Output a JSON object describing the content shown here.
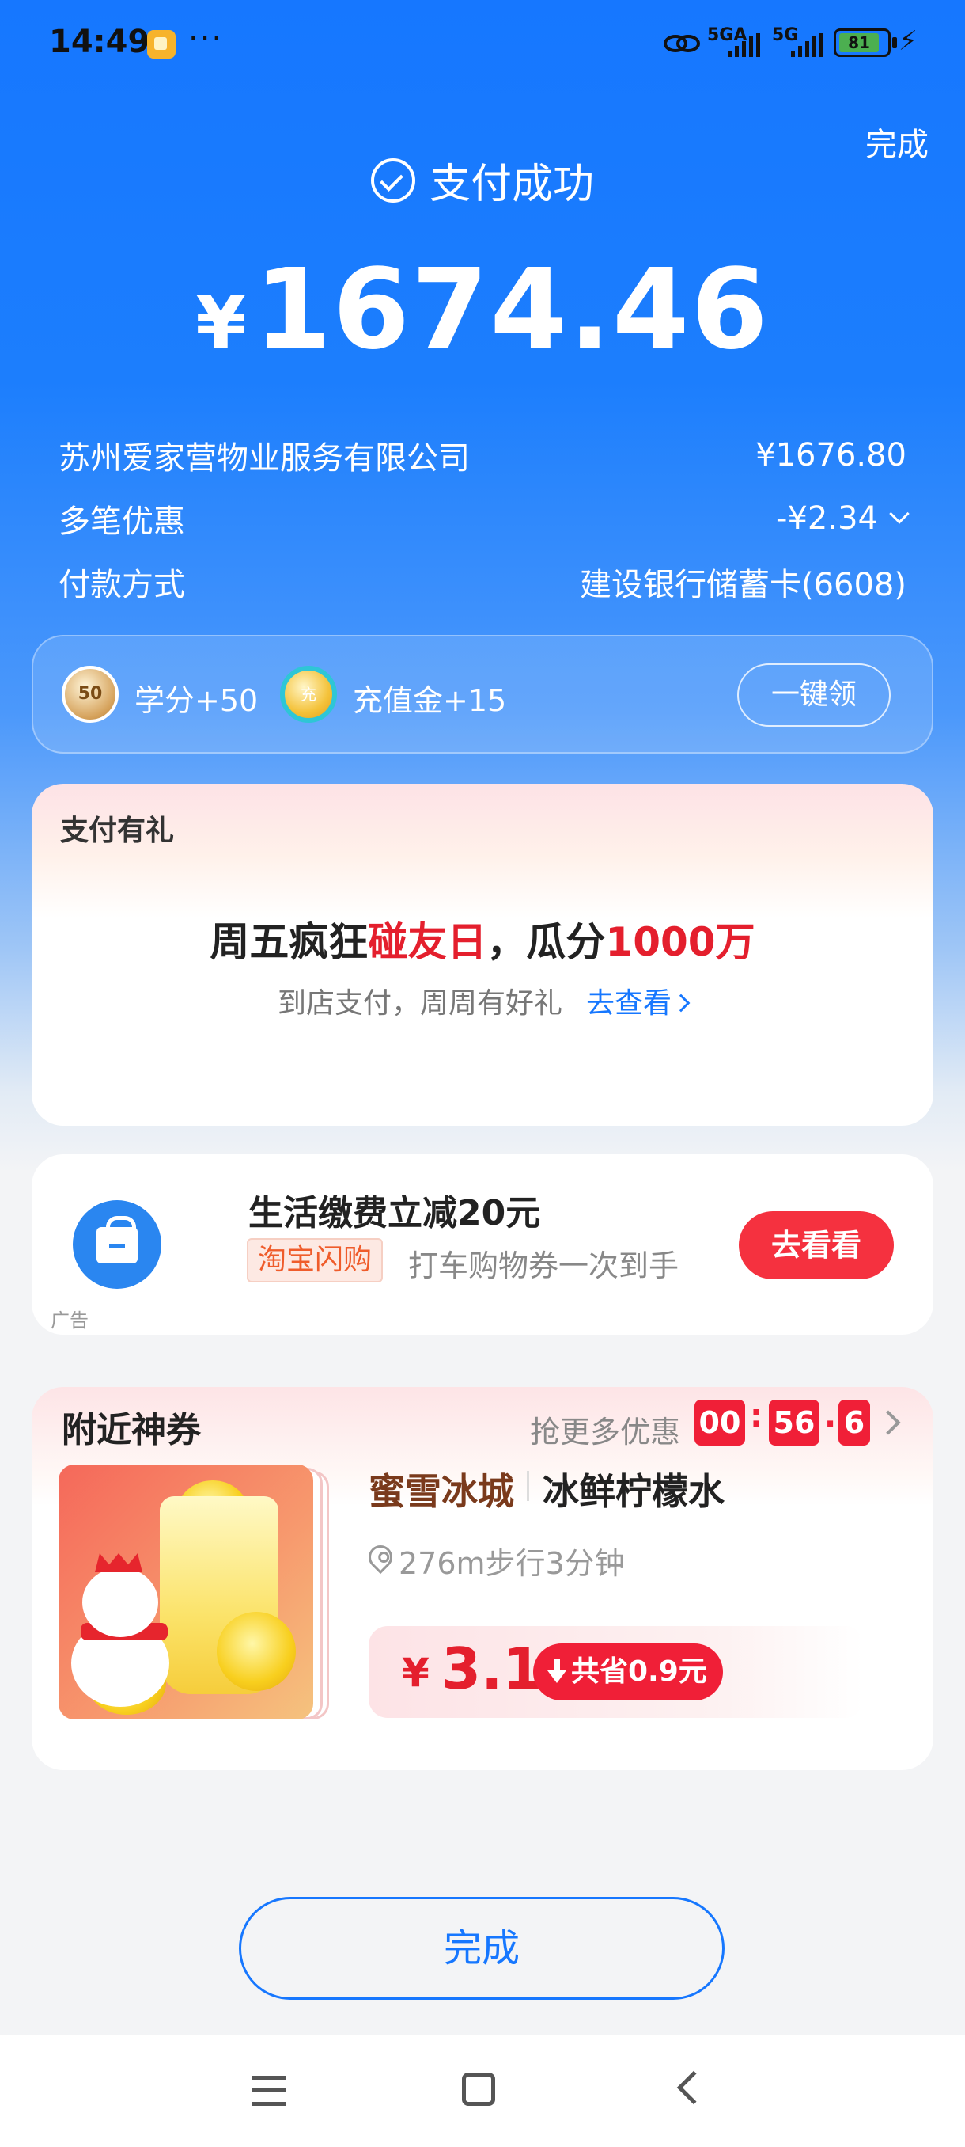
{
  "status_bar": {
    "time": "14:49",
    "dots": "···",
    "network_1": "5GA",
    "network_2": "5G",
    "battery": "81",
    "icons": [
      "app-notification-icon",
      "hd-link-icon",
      "signal-icon",
      "battery-icon",
      "charging-bolt-icon"
    ]
  },
  "header": {
    "done_top": "完成",
    "success_text": "支付成功",
    "currency_symbol": "¥",
    "amount": "1674.46"
  },
  "details": [
    {
      "label": "苏州爱家营物业服务有限公司",
      "value": "¥1676.80"
    },
    {
      "label": "多笔优惠",
      "value": "-¥2.34"
    },
    {
      "label": "付款方式",
      "value": "建设银行储蓄卡(6608)"
    }
  ],
  "rewards": {
    "credit_coin_text": "50",
    "credit_label": "学分+50",
    "gold_coin_text": "充",
    "gold_label": "充值金+15",
    "claim_button": "一键领"
  },
  "gift_card": {
    "title": "支付有礼",
    "headline_part1": "周五疯狂",
    "headline_red1": "碰友日",
    "headline_part2": "，瓜分",
    "headline_red2": "1000万",
    "subtitle": "到店支付，周周有好礼",
    "link": "去查看"
  },
  "ad_card": {
    "title": "生活缴费立减20元",
    "badge": "淘宝闪购",
    "desc": "打车购物券一次到手",
    "button": "去看看",
    "ad_tag": "广告"
  },
  "coupon_card": {
    "title": "附近神券",
    "more_deals": "抢更多优惠",
    "countdown": {
      "h": "00",
      "m": "56",
      "s": "6",
      "sep1": ":",
      "sep2": "."
    },
    "brand": "蜜雪冰城",
    "product": "冰鲜柠檬水",
    "distance": "276m步行3分钟",
    "price_symbol": "¥",
    "price": "3.1",
    "savings": "共省0.9元"
  },
  "footer": {
    "done_button": "完成"
  },
  "colors": {
    "primary_blue": "#1677ff",
    "accent_red": "#f01f37",
    "brand_brown": "#7a3a1c"
  }
}
